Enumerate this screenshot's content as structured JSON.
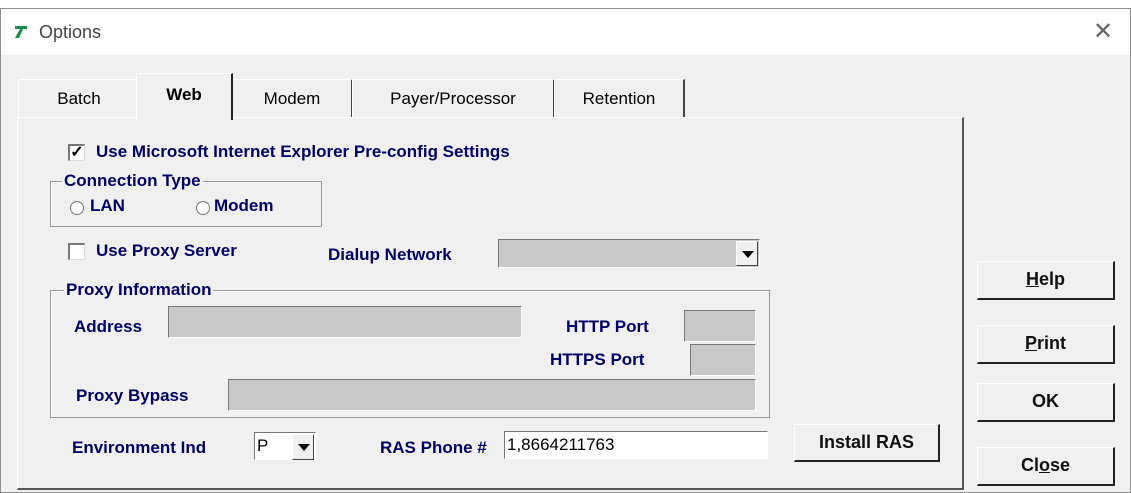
{
  "window": {
    "title": "Options",
    "close_glyph": "✕",
    "icon": "app-logo-icon"
  },
  "tabs": [
    {
      "label": "Batch",
      "active": false
    },
    {
      "label": "Web",
      "active": true
    },
    {
      "label": "Modem",
      "active": false
    },
    {
      "label": "Payer/Processor",
      "active": false
    },
    {
      "label": "Retention",
      "active": false
    }
  ],
  "web": {
    "use_ie_settings": {
      "label": "Use Microsoft Internet Explorer Pre-config Settings",
      "checked": true
    },
    "connection_type": {
      "legend": "Connection Type",
      "lan": "LAN",
      "modem": "Modem"
    },
    "use_proxy": {
      "label": "Use Proxy Server",
      "checked": false
    },
    "dialup": {
      "label": "Dialup Network",
      "value": ""
    },
    "proxy_info": {
      "legend": "Proxy Information",
      "address_label": "Address",
      "http_port_label": "HTTP Port",
      "https_port_label": "HTTPS Port",
      "bypass_label": "Proxy Bypass"
    },
    "environment": {
      "label": "Environment Ind",
      "value": "P"
    },
    "ras_phone": {
      "label": "RAS Phone #",
      "value": "1,8664211763"
    },
    "install_ras": "Install RAS"
  },
  "buttons": {
    "help": {
      "pre": "",
      "mn": "H",
      "post": "elp"
    },
    "print": {
      "pre": "",
      "mn": "P",
      "post": "rint"
    },
    "ok": "OK",
    "close": {
      "pre": "Cl",
      "mn": "o",
      "post": "se"
    }
  }
}
